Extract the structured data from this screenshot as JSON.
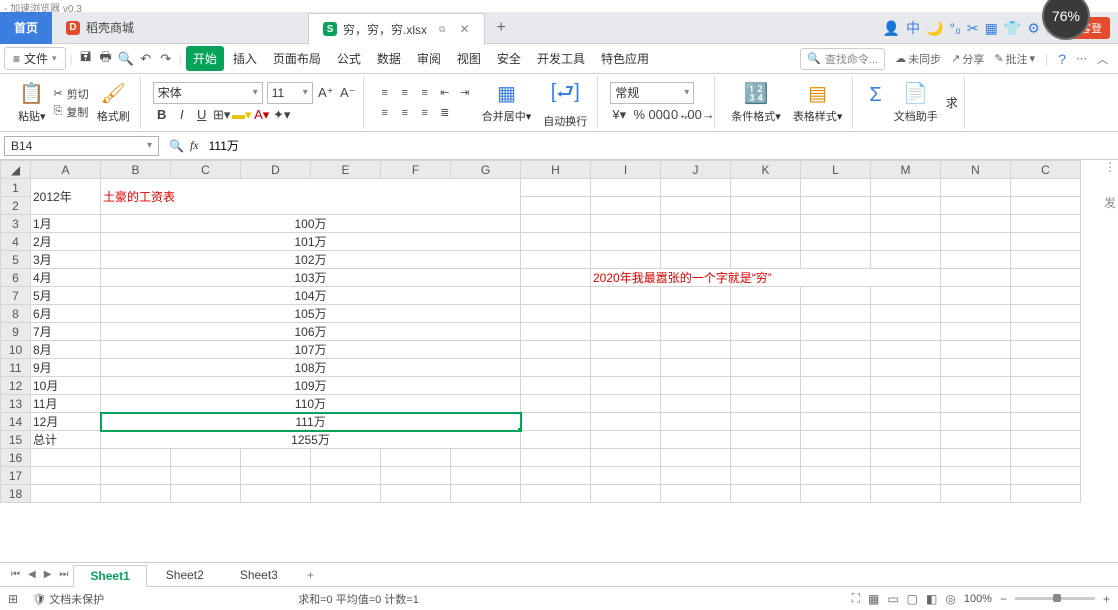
{
  "perf_badge": "76%",
  "titlebar_trace": "- 加速浏览器 v0.3",
  "tabs": {
    "home": "首页",
    "docke": {
      "icon": "D",
      "label": "稻壳商城"
    },
    "file": {
      "icon": "S",
      "label": "穷，穷，穷.xlsx"
    }
  },
  "guest_button": "访客登",
  "file_menu": "文件",
  "menutabs": [
    "开始",
    "插入",
    "页面布局",
    "公式",
    "数据",
    "审阅",
    "视图",
    "安全",
    "开发工具",
    "特色应用"
  ],
  "search_placeholder": "查找命令...",
  "cloud": {
    "unsync": "未同步",
    "share": "分享",
    "annotate": "批注"
  },
  "ribbon": {
    "paste": "粘贴",
    "cut": "剪切",
    "copy": "复制",
    "fmtpainter": "格式刷",
    "font_name": "宋体",
    "font_size": "11",
    "merge": "合并居中",
    "wrap": "自动换行",
    "numfmt": "常规",
    "condfmt": "条件格式",
    "tablestyle": "表格样式",
    "symbol": "符号",
    "dochelper": "文档助手",
    "sum": "求"
  },
  "namebox": "B14",
  "formula": "111万",
  "small_gutter": "34",
  "columns": [
    "A",
    "B",
    "C",
    "D",
    "E",
    "F",
    "G",
    "H",
    "I",
    "J",
    "K",
    "L",
    "M",
    "N",
    "C"
  ],
  "rows_header_max": 18,
  "cells": {
    "title_merged": "土豪的工资表",
    "A1": "2012年",
    "months": [
      "1月",
      "2月",
      "3月",
      "4月",
      "5月",
      "6月",
      "7月",
      "8月",
      "9月",
      "10月",
      "11月",
      "12月"
    ],
    "values": [
      "100万",
      "101万",
      "102万",
      "103万",
      "104万",
      "105万",
      "106万",
      "107万",
      "108万",
      "109万",
      "110万",
      "111万"
    ],
    "total_label": "总计",
    "total_value": "1255万",
    "note": "2020年我最嚣张的一个字就是“穷”"
  },
  "selection": {
    "cell": "B14:G14"
  },
  "sheet_tabs": [
    "Sheet1",
    "Sheet2",
    "Sheet3"
  ],
  "status": {
    "protect": "文档未保护",
    "sum": "求和=0  平均值=0  计数=1",
    "zoom": "100%"
  }
}
